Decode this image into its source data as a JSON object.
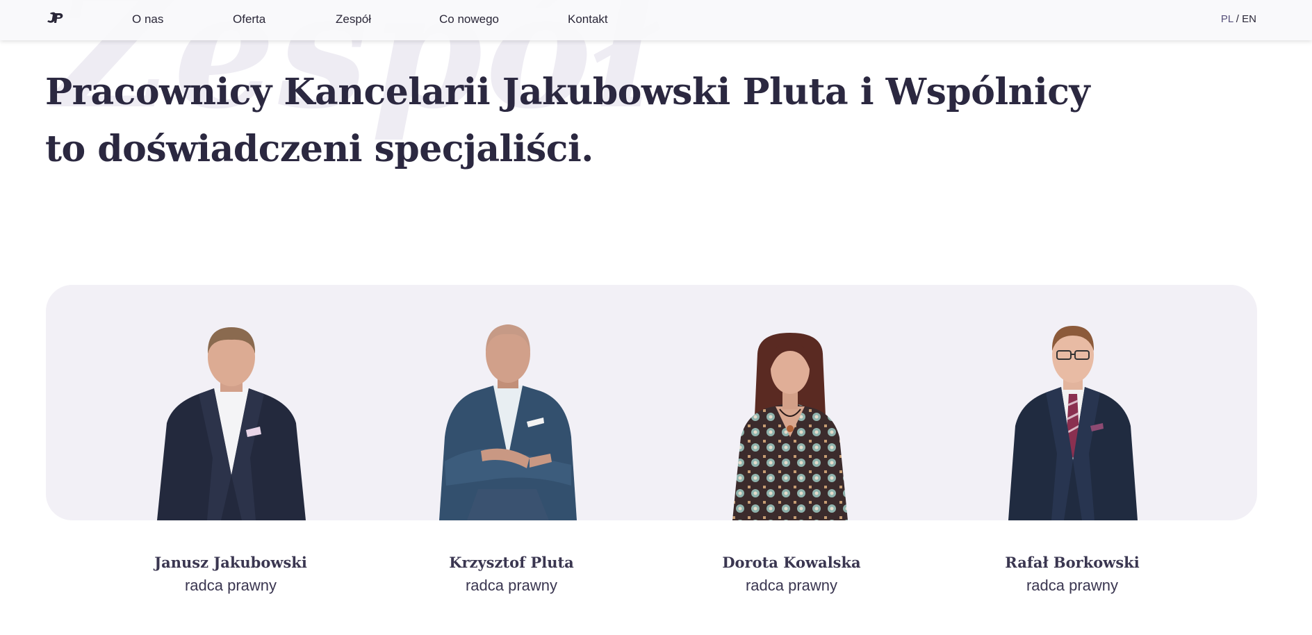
{
  "watermark": "Zespół",
  "header": {
    "nav": [
      "O nas",
      "Oferta",
      "Zespół",
      "Co nowego",
      "Kontakt"
    ],
    "lang_pl": "PL",
    "lang_sep": " / ",
    "lang_en": "EN"
  },
  "headline": "Pracownicy Kancelarii Jakubowski Pluta i Wspólnicy to doświadczeni specjaliści.",
  "team": [
    {
      "name": "Janusz Jakubowski",
      "role": "radca prawny"
    },
    {
      "name": "Krzysztof Pluta",
      "role": "radca prawny"
    },
    {
      "name": "Dorota Kowalska",
      "role": "radca prawny"
    },
    {
      "name": "Rafał Borkowski",
      "role": "radca prawny"
    }
  ],
  "colors": {
    "text_dark": "#2b2840",
    "panel_bg": "#f2f0f6",
    "watermark": "#eeecf3",
    "accent_lang": "#56507a"
  }
}
